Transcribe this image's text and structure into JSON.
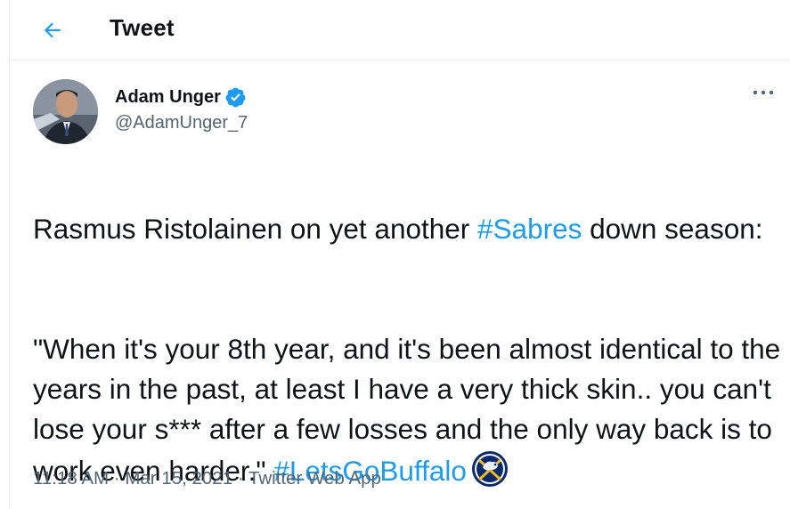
{
  "header": {
    "title": "Tweet"
  },
  "author": {
    "display_name": "Adam Unger",
    "handle": "@AdamUnger_7",
    "verified": true
  },
  "tweet": {
    "p1_text": "Rasmus Ristolainen on yet another ",
    "p1_hashtag": "#Sabres",
    "p1_tail": " down season:",
    "p2_text": "\"When it's your 8th year, and it's been almost identical to the years in the past, at least I have a very thick skin.. you can't lose your s*** after a few losses and the only way back is to work even harder.\" ",
    "p2_hashtag": "#LetsGoBuffalo",
    "emoji_icon": "buffalo-sabres-logo-icon"
  },
  "meta": {
    "time": "11:18 AM",
    "sep": " · ",
    "date": "Mar 15, 2021",
    "source": "Twitter Web App"
  },
  "colors": {
    "accent": "#1d9bf0",
    "secondary_text": "#536471",
    "text": "#0f1419"
  }
}
